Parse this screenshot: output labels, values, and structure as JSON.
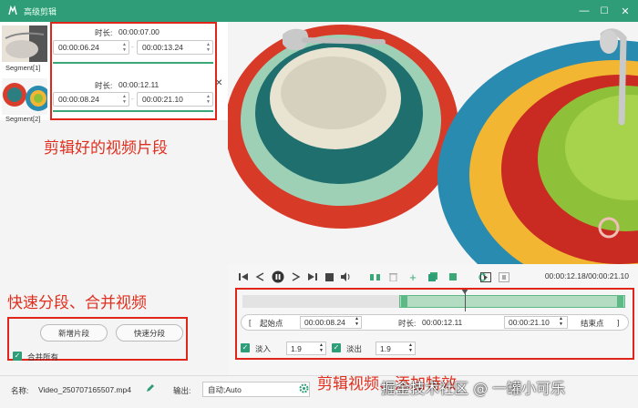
{
  "window": {
    "title": "高级剪辑",
    "min_glyph": "—",
    "max_glyph": "☐",
    "close_glyph": "✕"
  },
  "segments": [
    {
      "label": "Segment[1]",
      "duration_label": "时长:",
      "duration": "00:00:07.00",
      "start": "00:00:06.24",
      "end": "00:00:13.24"
    },
    {
      "label": "Segment[2]",
      "duration_label": "时长:",
      "duration": "00:00:12.11",
      "start": "00:00:08.24",
      "end": "00:00:21.10"
    }
  ],
  "left_controls": {
    "add_segment": "新增片段",
    "quick_split": "快速分段",
    "merge_all": "合并所有"
  },
  "player": {
    "time_current": "00:00:12.18",
    "time_total": "00:00:21.10"
  },
  "range": {
    "open_bracket": "[",
    "start_label": "起始点",
    "start": "00:00:08.24",
    "duration_label": "时长:",
    "duration": "00:00:12.11",
    "end": "00:00:21.10",
    "end_label": "结束点",
    "close_bracket": "]",
    "selection_start_fraction": 0.41,
    "selection_end_fraction": 1.0,
    "playhead_fraction": 0.58
  },
  "effects": {
    "fade_in_label": "淡入",
    "fade_in_value": "1.9",
    "fade_out_label": "淡出",
    "fade_out_value": "1.9"
  },
  "bottom": {
    "name_label": "名称:",
    "name_value": "Video_250707165507.mp4",
    "output_label": "输出:",
    "output_value": "自动;Auto"
  },
  "annotations": {
    "clips": "剪辑好的视频片段",
    "split_merge": "快速分段、合并视频",
    "fx": "剪辑视频、添加特效",
    "watermark": "掘金技术社区 @ 一罐小可乐"
  },
  "colors": {
    "brand": "#2f9e78",
    "annotation": "#e0261b",
    "selection": "#b4dcc3"
  }
}
